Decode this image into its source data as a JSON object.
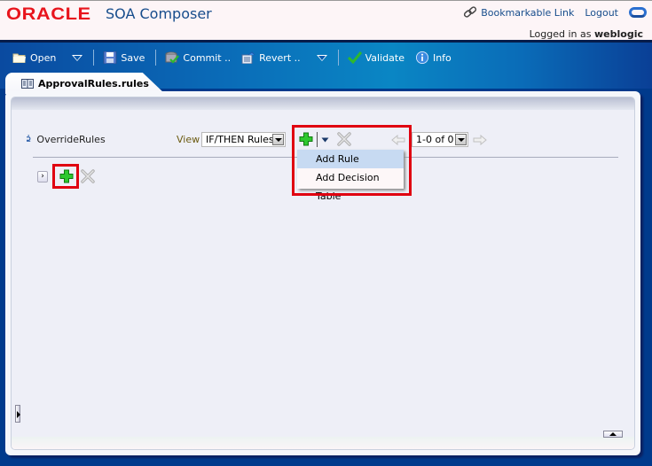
{
  "header": {
    "brand": "ORACLE",
    "app_title": "SOA Composer",
    "bookmarkable_link": "Bookmarkable Link",
    "logout": "Logout",
    "logged_in_prefix": "Logged in as",
    "username": "weblogic"
  },
  "toolbar": {
    "open": "Open",
    "save": "Save",
    "commit": "Commit ..",
    "revert": "Revert ..",
    "validate": "Validate",
    "info": "Info"
  },
  "tab": {
    "label": "ApprovalRules.rules"
  },
  "ruleset": {
    "name": "OverrideRules",
    "view_label": "View",
    "view_value": "IF/THEN Rules",
    "pagination_value": "1-0 of 0"
  },
  "add_menu": {
    "items": [
      {
        "label": "Add Rule",
        "highlighted": true
      },
      {
        "label": "Add Decision Table",
        "highlighted": false
      }
    ]
  },
  "colors": {
    "brand_red": "#e8151d",
    "title_blue": "#174d8c",
    "highlight_box": "#e00010",
    "menu_highlight": "#c7daf2"
  }
}
